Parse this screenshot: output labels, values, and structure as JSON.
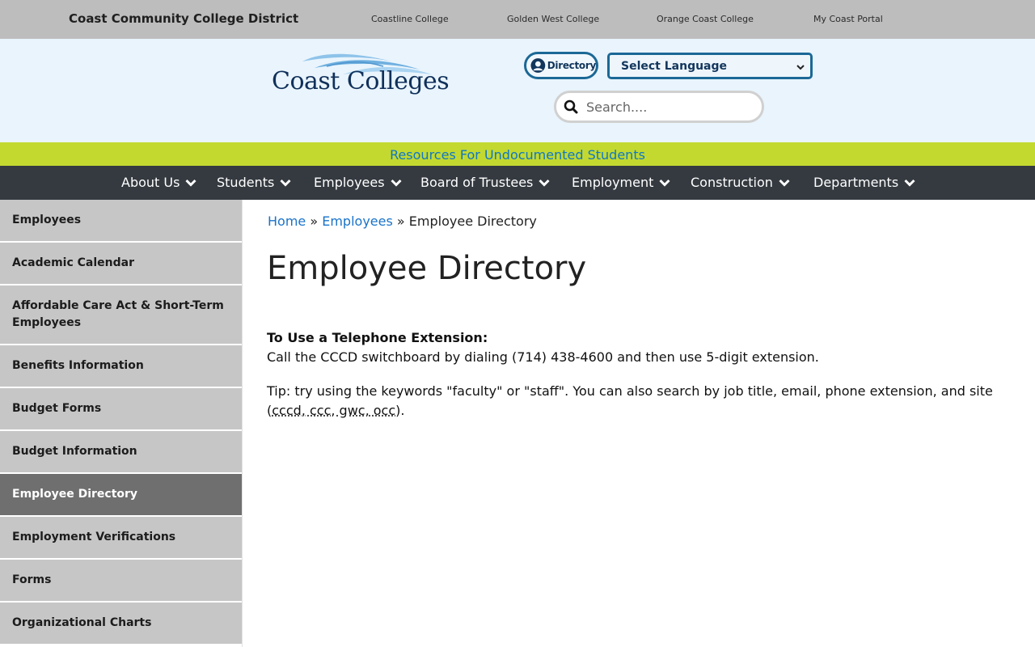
{
  "topbar": {
    "district_name": "Coast Community College District",
    "links": [
      {
        "label": "Coastline College"
      },
      {
        "label": "Golden West College"
      },
      {
        "label": "Orange Coast College"
      },
      {
        "label": "My Coast Portal"
      }
    ]
  },
  "header": {
    "logo_text": "Coast Colleges",
    "directory_label": "Directory",
    "language_select": "Select Language",
    "search_placeholder": "Search...."
  },
  "announcement": {
    "label": "Resources For Undocumented Students"
  },
  "nav": {
    "items": [
      {
        "label": "About Us"
      },
      {
        "label": "Students"
      },
      {
        "label": "Employees"
      },
      {
        "label": "Board of Trustees"
      },
      {
        "label": "Employment"
      },
      {
        "label": "Construction"
      },
      {
        "label": "Departments"
      }
    ]
  },
  "sidebar": {
    "items": [
      {
        "label": "Employees"
      },
      {
        "label": "Academic Calendar"
      },
      {
        "label": "Affordable Care Act & Short-Term Employees"
      },
      {
        "label": "Benefits Information"
      },
      {
        "label": "Budget Forms"
      },
      {
        "label": "Budget Information"
      },
      {
        "label": "Employee Directory",
        "active": true
      },
      {
        "label": "Employment Verifications"
      },
      {
        "label": "Forms"
      },
      {
        "label": "Organizational Charts"
      }
    ]
  },
  "breadcrumb": {
    "home": "Home",
    "sep1": "»",
    "section": "Employees",
    "sep2": "»",
    "current": "Employee Directory"
  },
  "content": {
    "title": "Employee Directory",
    "ext_heading": "To Use a Telephone Extension:",
    "ext_text": "Call the CCCD switchboard by dialing (714) 438-4600 and then use 5-digit extension.",
    "tip_prefix": "Tip: try using the keywords \"faculty\" or \"staff\". You can also search by job title, email, phone extension, and site (",
    "tip_sites": "cccd, ccc, gwc, occ",
    "tip_suffix": ")."
  },
  "colors": {
    "topbar_bg": "#bdbdbd",
    "header_bg": "#e9f4fc",
    "announce_bg": "#c3d92f",
    "nav_bg": "#343a40",
    "link": "#1a73c9",
    "sidebar_bg": "#c6c6c6",
    "sidebar_active_bg": "#6f6f6f"
  }
}
